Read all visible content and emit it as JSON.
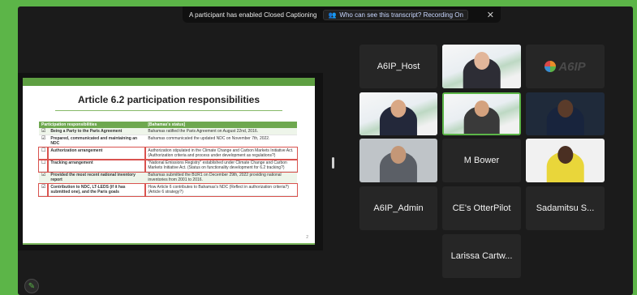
{
  "caption_bar": {
    "message": "A participant has enabled Closed Captioning",
    "transcript_link": "Who can see this transcript? Recording On",
    "close_glyph": "✕"
  },
  "slide": {
    "title": "Article 6.2 participation responsibilities",
    "headers": [
      "Participation responsibilities",
      "[Bahamas's status]"
    ],
    "rows": [
      {
        "check": "☑",
        "resp": "Being a Party to the Paris Agreement",
        "status": "Bahamas ratified the Paris Agreement on August 22nd, 2016."
      },
      {
        "check": "☑",
        "resp": "Prepared, communicated and maintaining an NDC",
        "status": "Bahamas communicated the updated NDC on November 7th, 2022."
      },
      {
        "check": "☐",
        "resp": "Authorization arrangement",
        "status": "Authorization stipulated in the Climate Change and Carbon Markets Initiative Act. (Authorization criteria and process under development as regulations?)"
      },
      {
        "check": "☐",
        "resp": "Tracking arrangement",
        "status": "\"National Emissions Registry\" established under Climate Change and Carbon Markets Initiative Act. (Status on functionality development for 6.2 tracking?)"
      },
      {
        "check": "☑",
        "resp": "Provided the most recent national inventory report",
        "status": "Bahamas submitted the BUR1 on December 29th, 2022 providing national inventories from 2001 to 2016."
      },
      {
        "check": "☑",
        "resp": "Contribution to NDC, LT-LEDS (if it has submitted one), and the Paris goals",
        "status": "How Article 6 contributes to Bahamas's NDC (Reflect in authorization criteria?) (Article 6 strategy?)"
      }
    ],
    "page_number": "2"
  },
  "participants": [
    {
      "name": "A6IP_Host"
    },
    {
      "name": "M Bower"
    },
    {
      "name": "A6IP_Admin"
    },
    {
      "name": "CE's OtterPilot"
    },
    {
      "name": "Sadamitsu S..."
    },
    {
      "name": "Larissa Cartw..."
    }
  ],
  "logo_text": "A6IP",
  "colors": {
    "accent": "#5cb548",
    "slide_green": "#6ea84f",
    "highlight_red": "#d9534f"
  }
}
